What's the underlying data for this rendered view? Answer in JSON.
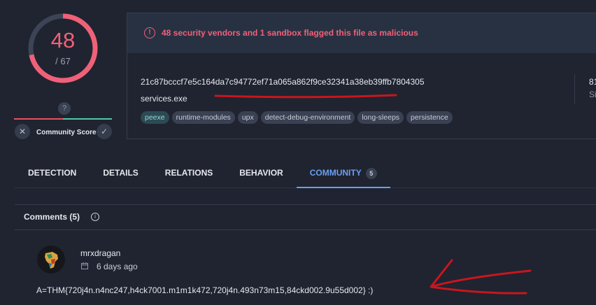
{
  "score": {
    "detections": "48",
    "total": "/ 67",
    "detections_fraction": 0.716,
    "unknown_mark": "?",
    "community_label": "Community Score",
    "vote_down": "✕",
    "vote_up": "✓"
  },
  "alert": {
    "icon": "!",
    "text": "48 security vendors and 1 sandbox flagged this file as malicious"
  },
  "file": {
    "hash": "21c87bcccf7e5c164da7c94772ef71a065a862f9ce32341a38eb39ffb7804305",
    "name": "services.exe",
    "side_number": "81",
    "side_label": "Si"
  },
  "tags": [
    "peexe",
    "runtime-modules",
    "upx",
    "detect-debug-environment",
    "long-sleeps",
    "persistence"
  ],
  "tabs": [
    {
      "label": "DETECTION"
    },
    {
      "label": "DETAILS"
    },
    {
      "label": "RELATIONS"
    },
    {
      "label": "BEHAVIOR"
    },
    {
      "label": "COMMUNITY",
      "count": "5"
    }
  ],
  "comments": {
    "title": "Comments",
    "count": "(5)",
    "info_icon": "i",
    "items": [
      {
        "author": "mrxdragan",
        "time": "6 days ago",
        "text": "A=THM{720j4n.n4nc247,h4ck7001.m1m1k472,720j4n.493n73m15,84ckd002.9u55d002} :)"
      }
    ]
  },
  "colors": {
    "malicious": "#f06178",
    "accent": "#6c9ef0",
    "annotation": "#c8161d"
  }
}
